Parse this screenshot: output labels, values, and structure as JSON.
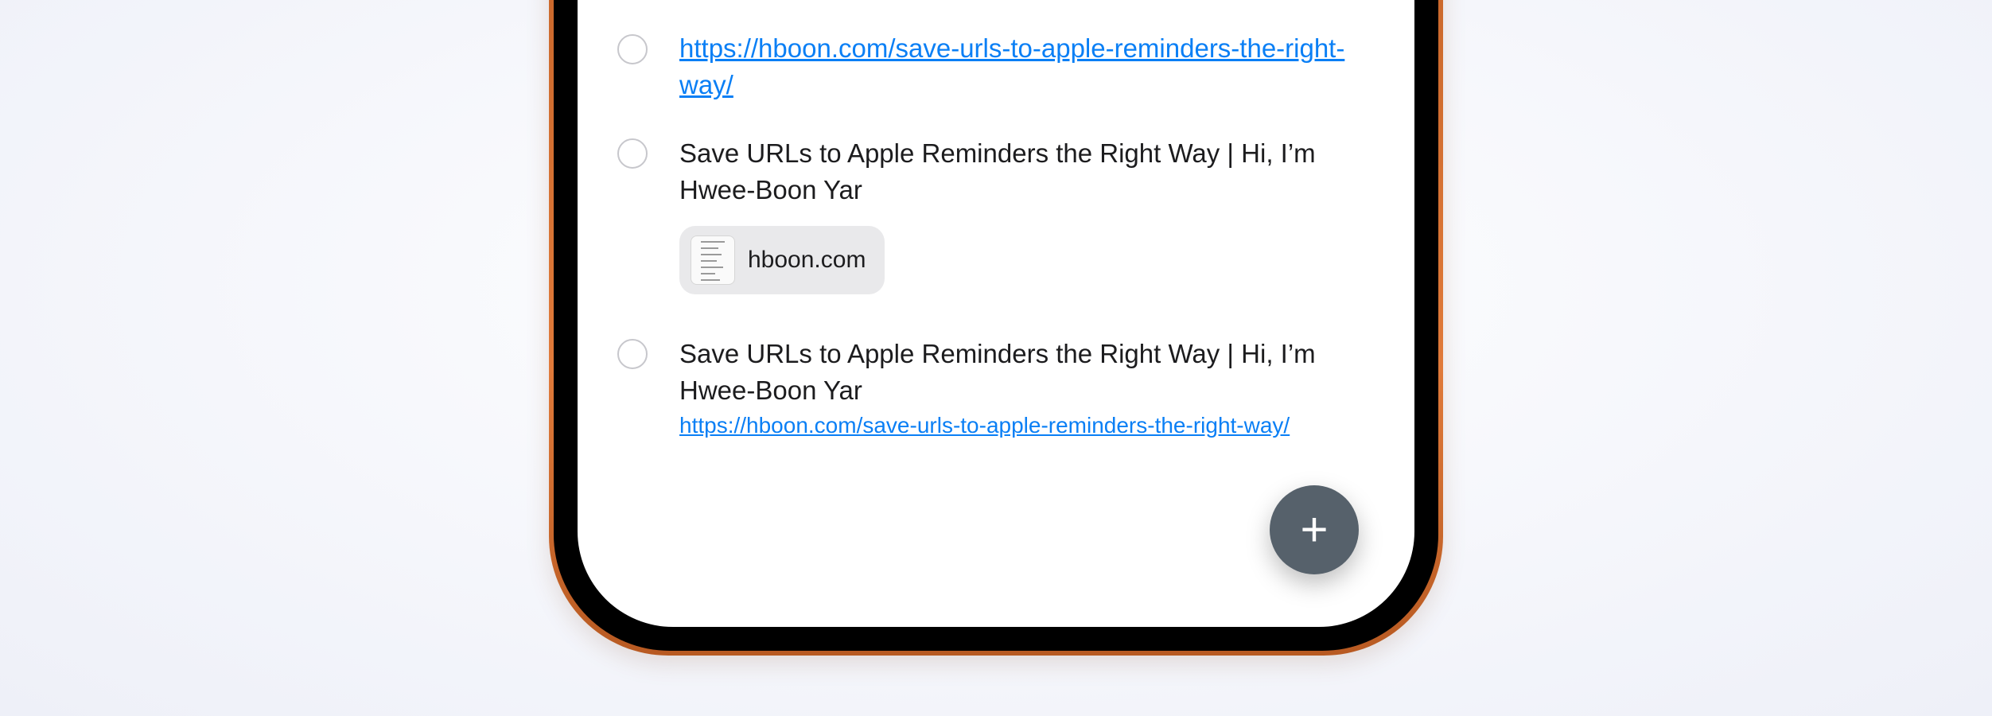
{
  "reminders": [
    {
      "title_link": "https://hboon.com/save-urls-to-apple-reminders-the-right-way/"
    },
    {
      "title": "Save URLs to Apple Reminders the Right Way | Hi, I’m Hwee-Boon Yar",
      "attachment": {
        "label": "hboon.com",
        "icon": "webpage-thumbnail-icon"
      }
    },
    {
      "title": "Save URLs to Apple Reminders the Right Way | Hi, I’m Hwee-Boon Yar",
      "url": "https://hboon.com/save-urls-to-apple-reminders-the-right-way/"
    }
  ],
  "add_button": {
    "label": "+",
    "icon": "plus-icon"
  },
  "colors": {
    "link": "#0a7ff5",
    "frame": "#d86f30",
    "fab": "#56616b",
    "chip": "#e9e9eb"
  }
}
